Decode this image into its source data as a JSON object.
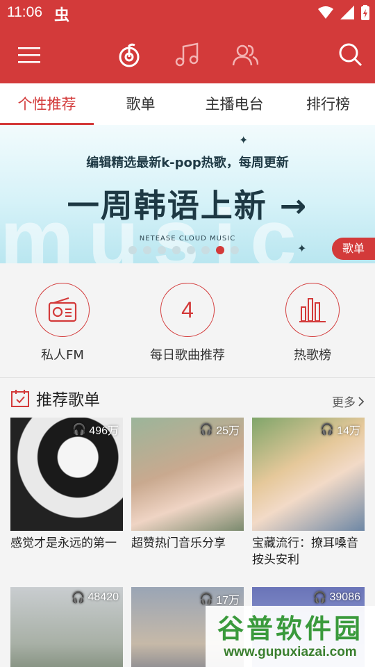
{
  "status": {
    "time": "11:06",
    "notif_glyph": "虫"
  },
  "header": {
    "icons": [
      "menu-icon",
      "netease-music-icon",
      "music-note-icon",
      "friends-icon",
      "search-icon"
    ]
  },
  "tabs": [
    {
      "label": "个性推荐",
      "active": true
    },
    {
      "label": "歌单",
      "active": false
    },
    {
      "label": "主播电台",
      "active": false
    },
    {
      "label": "排行榜",
      "active": false
    }
  ],
  "banner": {
    "subtitle": "编辑精选最新k-pop热歌，每周更新",
    "title": "一周韩语上新 →",
    "brand": "NETEASE CLOUD MUSIC",
    "watermark": "music",
    "badge": "歌单",
    "dots_total": 8,
    "dots_active_index": 6
  },
  "quick": [
    {
      "label": "私人FM",
      "icon": "radio-icon"
    },
    {
      "label": "每日歌曲推荐",
      "number": "4"
    },
    {
      "label": "热歌榜",
      "icon": "chart-bars-icon"
    }
  ],
  "section": {
    "title": "推荐歌单",
    "more": "更多"
  },
  "playlists": [
    {
      "plays": "496万",
      "name": "感觉才是永远的第一"
    },
    {
      "plays": "25万",
      "name": "超赞热门音乐分享"
    },
    {
      "plays": "14万",
      "name": "宝藏流行：撩耳嗓音按头安利"
    },
    {
      "plays": "48420",
      "name": ""
    },
    {
      "plays": "17万",
      "name": ""
    },
    {
      "plays": "39086",
      "name": ""
    }
  ],
  "watermark": {
    "title": "谷普软件园",
    "url": "www.gupuxiazai.com"
  },
  "colors": {
    "brand_red": "#d33a3a"
  }
}
